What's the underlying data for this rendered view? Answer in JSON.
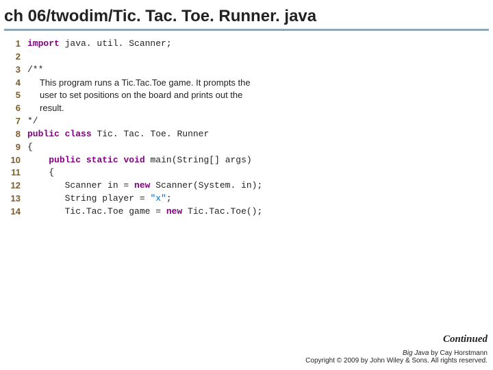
{
  "title": "ch 06/twodim/Tic. Tac. Toe. Runner. java",
  "lines": {
    "l1": {
      "num": "1",
      "kw": "import",
      "rest": " java. util. Scanner;"
    },
    "l2": {
      "num": "2"
    },
    "l3": {
      "num": "3",
      "text": "/**"
    },
    "l4": {
      "num": "4",
      "text": "     This program runs a Tic.Tac.Toe game. It prompts the"
    },
    "l5": {
      "num": "5",
      "text": "     user to set positions on the board and prints out the"
    },
    "l6": {
      "num": "6",
      "text": "     result."
    },
    "l7": {
      "num": "7",
      "text": "*/"
    },
    "l8": {
      "num": "8",
      "kw1": "public",
      "kw2": "class",
      "rest": " Tic. Tac. Toe. Runner"
    },
    "l9": {
      "num": "9",
      "text": "{"
    },
    "l10": {
      "num": "10",
      "indent": "    ",
      "kw1": "public",
      "kw2": "static",
      "kw3": "void",
      "rest": " main(String[] args)"
    },
    "l11": {
      "num": "11",
      "text": "    {"
    },
    "l12": {
      "num": "12",
      "pre": "       Scanner in = ",
      "kw": "new",
      "post": " Scanner(System. in);"
    },
    "l13": {
      "num": "13",
      "pre": "       String player = ",
      "str": "\"x\"",
      "post": ";"
    },
    "l14": {
      "num": "14",
      "pre": "       Tic.Tac.Toe game = ",
      "kw": "new",
      "post": " Tic.Tac.Toe();"
    }
  },
  "footer": {
    "continued": "Continued",
    "credit1a": "Big Java",
    "credit1b": " by Cay Horstmann",
    "credit2": "Copyright © 2009 by John Wiley & Sons.  All rights reserved."
  }
}
